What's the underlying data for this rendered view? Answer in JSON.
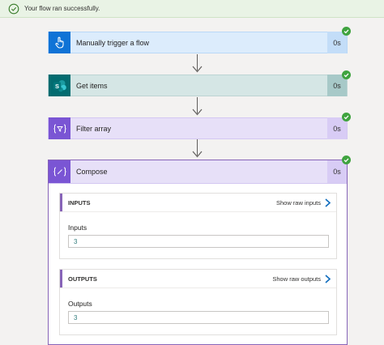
{
  "banner": {
    "message": "Your flow ran successfully."
  },
  "steps": [
    {
      "title": "Manually trigger a flow",
      "duration": "0s"
    },
    {
      "title": "Get items",
      "duration": "0s"
    },
    {
      "title": "Filter array",
      "duration": "0s"
    }
  ],
  "compose": {
    "title": "Compose",
    "duration": "0s",
    "inputs": {
      "header": "INPUTS",
      "raw_link": "Show raw inputs",
      "field_label": "Inputs",
      "value": "3"
    },
    "outputs": {
      "header": "OUTPUTS",
      "raw_link": "Show raw outputs",
      "field_label": "Outputs",
      "value": "3"
    }
  },
  "icons": {
    "success": "check-circle-icon",
    "trigger": "touch-hand-icon",
    "getitems": "sharepoint-icon",
    "filter": "filter-array-icon",
    "compose": "compose-icon",
    "chevron": "chevron-right-icon"
  },
  "colors": {
    "success_green": "#3fa33f",
    "trigger_blue": "#0f73d6",
    "sharepoint_teal": "#036c70",
    "dataop_purple": "#7a55d4",
    "link_blue": "#0f6cbd"
  }
}
